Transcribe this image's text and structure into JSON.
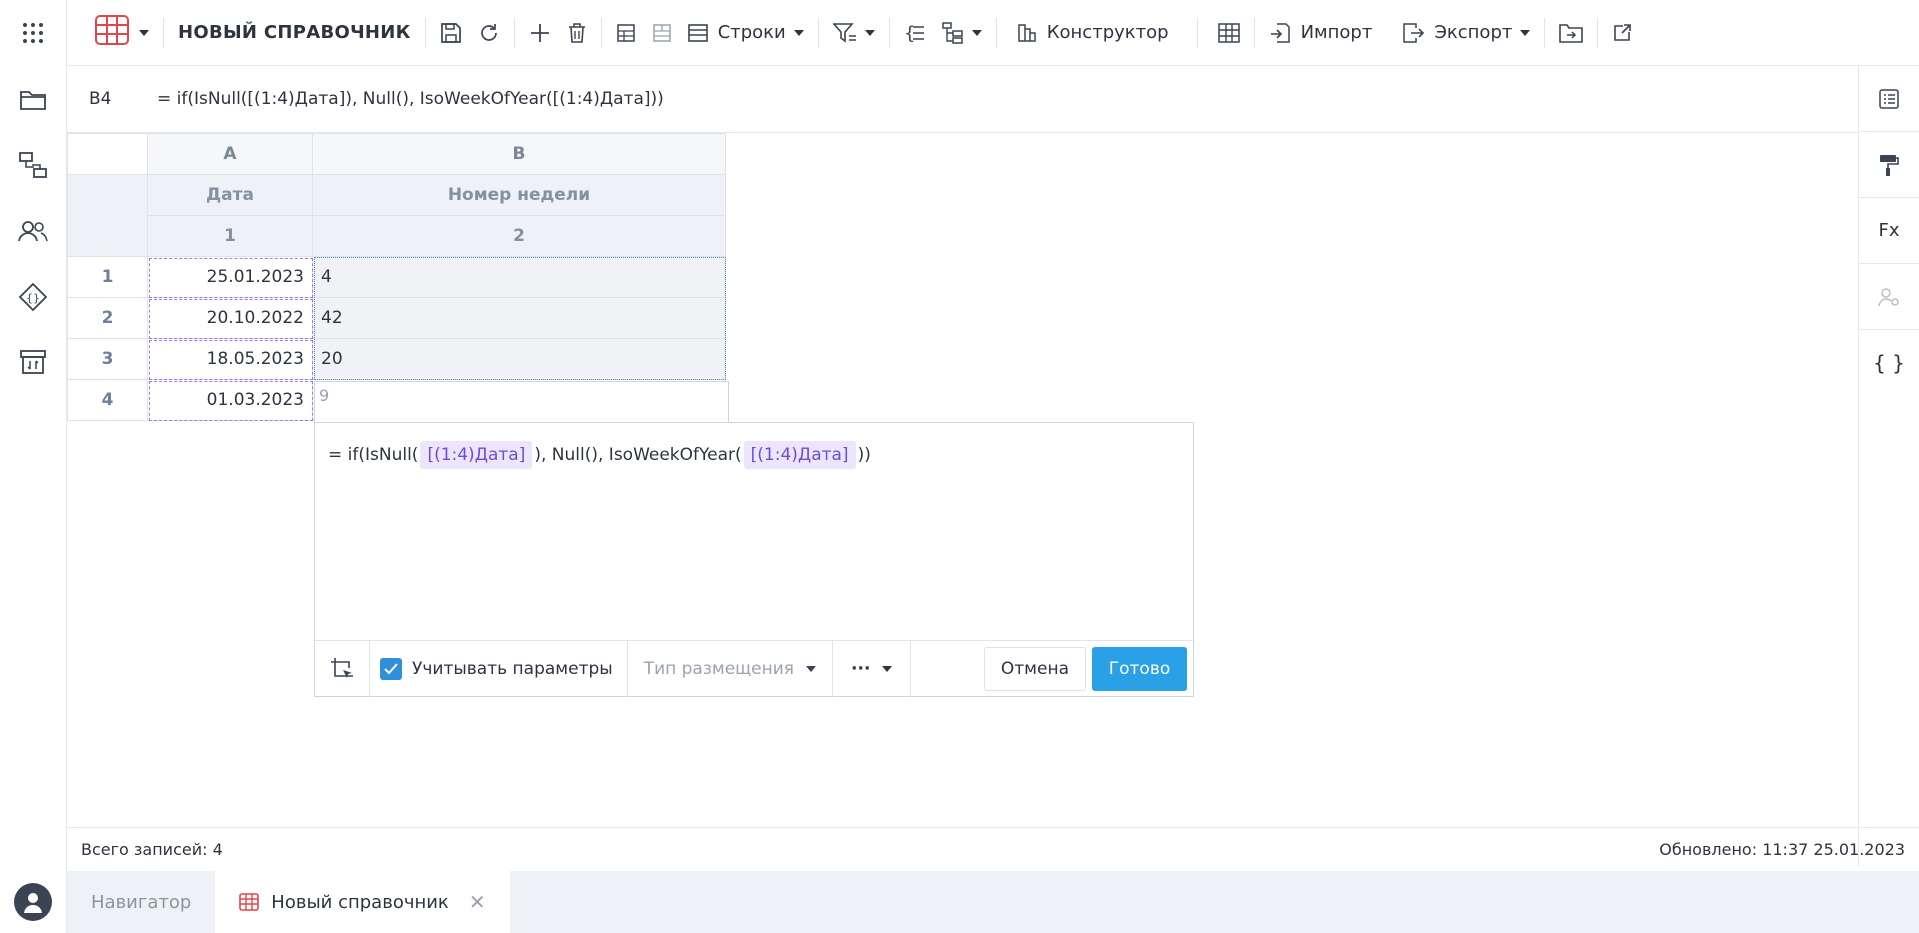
{
  "toolbar": {
    "title": "НОВЫЙ СПРАВОЧНИК",
    "rows_label": "Строки",
    "constructor_label": "Конструктор",
    "import_label": "Импорт",
    "export_label": "Экспорт"
  },
  "formula_bar": {
    "cell_ref": "B4",
    "formula": "= if(IsNull([(1:4)Дата]), Null(), IsoWeekOfYear([(1:4)Дата]))"
  },
  "right_rail": {
    "fx_label": "Fx"
  },
  "grid": {
    "col_letters": [
      "A",
      "B"
    ],
    "col_titles": [
      "Дата",
      "Номер недели"
    ],
    "col_numbers": [
      "1",
      "2"
    ],
    "rows": [
      {
        "num": "1",
        "date": "25.01.2023",
        "week": "4"
      },
      {
        "num": "2",
        "date": "20.10.2022",
        "week": "42"
      },
      {
        "num": "3",
        "date": "18.05.2023",
        "week": "20"
      },
      {
        "num": "4",
        "date": "01.03.2023",
        "week": ""
      }
    ]
  },
  "editor": {
    "preview_value": "9",
    "text_prefix": "= if(IsNull(",
    "chip_ref": "[(1:4)Дата]",
    "text_middle": "), Null(), IsoWeekOfYear(",
    "text_suffix": "))",
    "consider_params_label": "Учитывать параметры",
    "placement_type_label": "Тип размещения",
    "more_label": "···",
    "cancel_label": "Отмена",
    "done_label": "Готово"
  },
  "status": {
    "total_records": "Всего записей: 4",
    "updated": "Обновлено: 11:37 25.01.2023"
  },
  "tabs": [
    {
      "label": "Навигатор"
    },
    {
      "label": "Новый справочник"
    }
  ],
  "colors": {
    "accent": "#2aa0e6",
    "chip_bg": "#ece5fb",
    "chip_text": "#6b4dd6",
    "brand_red": "#e0474c"
  }
}
